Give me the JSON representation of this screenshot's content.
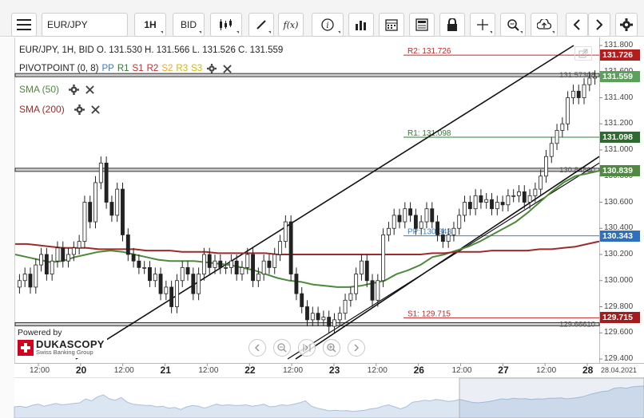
{
  "toolbar": {
    "menu_icon": "hamburger-icon",
    "symbol": "EUR/JPY",
    "timeframe": "1H",
    "side": "BID",
    "buttons": [
      "candles-icon",
      "draw-icon",
      "fx-icon",
      "info-icon",
      "volume-icon",
      "calendar-icon",
      "news-icon",
      "lock-icon",
      "crosshair-icon",
      "zoom-icon",
      "upload-icon",
      "prev-icon",
      "next-icon",
      "settings-icon"
    ],
    "fx_label": "f(x)"
  },
  "header": {
    "ohlc_text": "EUR/JPY, 1H, BID   O. 131.530  H. 131.566  L. 131.526  C. 131.559",
    "pivot_label": "PIVOTPOINT (0, 8)",
    "pivot_items": [
      {
        "text": "PP",
        "color": "#2e7fd8"
      },
      {
        "text": "R1",
        "color": "#2e7d32"
      },
      {
        "text": "S1",
        "color": "#c62828"
      },
      {
        "text": "R2",
        "color": "#c62828"
      },
      {
        "text": "S2",
        "color": "#f5a623"
      },
      {
        "text": "R3",
        "color": "#f5c400"
      },
      {
        "text": "S3",
        "color": "#f5c400"
      }
    ],
    "sma50_label": "SMA (50)",
    "sma200_label": "SMA (200)",
    "sma50_color": "#4c8a3c",
    "sma200_color": "#9e2a2a"
  },
  "chart_data": {
    "type": "line",
    "title": "EUR/JPY, 1H, BID",
    "x_labels": [
      "12:00",
      "20",
      "12:00",
      "21",
      "12:00",
      "22",
      "12:00",
      "23",
      "12:00",
      "26",
      "12:00",
      "27",
      "12:00",
      "28"
    ],
    "ylim": [
      129.4,
      131.8
    ],
    "y_ticks": [
      129.4,
      129.6,
      129.8,
      130.0,
      130.2,
      130.4,
      130.6,
      130.8,
      131.0,
      131.2,
      131.4,
      131.6,
      131.8
    ],
    "y_tick_labels": [
      "129.400",
      "129.600",
      "129.800",
      "130.000",
      "130.200",
      "130.400",
      "130.600",
      "130.800",
      "131.000",
      "131.200",
      "131.400",
      "131.600",
      "131.800"
    ],
    "ohlc": {
      "open": 131.53,
      "high": 131.566,
      "low": 131.526,
      "close": 131.559
    },
    "close_series": [
      130.0,
      130.05,
      129.95,
      130.12,
      130.2,
      130.05,
      130.15,
      130.25,
      130.15,
      130.2,
      130.25,
      130.3,
      130.6,
      130.45,
      130.75,
      130.9,
      130.6,
      130.5,
      130.7,
      130.35,
      130.2,
      130.15,
      130.1,
      130.1,
      130.0,
      130.05,
      129.9,
      129.95,
      129.8,
      130.0,
      130.1,
      130.05,
      129.9,
      130.05,
      130.2,
      130.1,
      130.15,
      130.1,
      130.1,
      130.15,
      130.05,
      130.1,
      130.2,
      130.0,
      130.05,
      130.15,
      130.1,
      130.2,
      130.3,
      130.45,
      130.05,
      129.9,
      129.8,
      129.7,
      129.75,
      129.7,
      129.72,
      129.65,
      129.7,
      129.75,
      129.85,
      129.9,
      130.05,
      130.15,
      130.0,
      129.85,
      130.0,
      130.35,
      130.4,
      130.5,
      130.45,
      130.55,
      130.5,
      130.4,
      130.45,
      130.55,
      130.45,
      130.35,
      130.3,
      130.35,
      130.4,
      130.5,
      130.6,
      130.55,
      130.65,
      130.6,
      130.62,
      130.55,
      130.6,
      130.58,
      130.65,
      130.65,
      130.68,
      130.6,
      130.65,
      130.7,
      130.8,
      130.95,
      131.05,
      131.15,
      131.2,
      131.4,
      131.45,
      131.4,
      131.5,
      131.55,
      131.56
    ],
    "series": [
      {
        "name": "SMA (50)",
        "values": [
          130.2,
          130.18,
          130.16,
          130.14,
          130.15,
          130.18,
          130.2,
          130.22,
          130.23,
          130.22,
          130.2,
          130.18,
          130.16,
          130.15,
          130.15,
          130.15,
          130.14,
          130.13,
          130.12,
          130.1,
          130.08,
          130.05,
          130.02,
          130.0,
          129.99,
          129.97,
          129.96,
          129.95,
          129.95,
          129.96,
          129.98,
          130.0,
          130.05,
          130.08,
          130.12,
          130.18,
          130.2,
          130.23,
          130.26,
          130.3,
          130.35,
          130.4,
          130.45,
          130.52,
          130.6,
          130.68,
          130.75,
          130.8,
          130.82,
          130.84
        ]
      },
      {
        "name": "SMA (200)",
        "values": [
          130.28,
          130.28,
          130.27,
          130.26,
          130.25,
          130.25,
          130.25,
          130.24,
          130.24,
          130.24,
          130.24,
          130.23,
          130.23,
          130.23,
          130.22,
          130.22,
          130.22,
          130.21,
          130.21,
          130.21,
          130.21,
          130.21,
          130.2,
          130.2,
          130.2,
          130.2,
          130.2,
          130.2,
          130.2,
          130.2,
          130.2,
          130.2,
          130.2,
          130.2,
          130.2,
          130.21,
          130.21,
          130.22,
          130.22,
          130.22,
          130.23,
          130.23,
          130.23,
          130.23,
          130.24,
          130.24,
          130.25,
          130.26,
          130.28,
          130.3
        ]
      }
    ],
    "pivot_levels": [
      {
        "name": "R2",
        "text": "R2: 131.726",
        "value": 131.726,
        "color": "#c62828"
      },
      {
        "name": "R1",
        "text": "R1: 131.098",
        "value": 131.098,
        "color": "#2e7d32"
      },
      {
        "name": "PP",
        "text": "PP: 130.343",
        "value": 130.343,
        "color": "#2e7fd8"
      },
      {
        "name": "S1",
        "text": "S1: 129.715",
        "value": 129.715,
        "color": "#c62828"
      }
    ],
    "horizontal_lines": [
      {
        "text": "131.57308",
        "value": 131.57308
      },
      {
        "text": "130.84800",
        "value": 130.848
      },
      {
        "text": "129.66610",
        "value": 129.6661
      }
    ],
    "price_tags": [
      {
        "text": "131.726",
        "value": 131.726,
        "color": "#b71c1c"
      },
      {
        "text": "131.559",
        "value": 131.559,
        "color": "#5aa15a"
      },
      {
        "text": "131.098",
        "value": 131.098,
        "color": "#2e6b2e"
      },
      {
        "text": "130.839",
        "value": 130.839,
        "color": "#4f8a3f"
      },
      {
        "text": "130.343",
        "value": 130.343,
        "color": "#2f6fbf"
      },
      {
        "text": "129.715",
        "value": 129.715,
        "color": "#a61c1c"
      }
    ],
    "grid": false,
    "legend": "top-left"
  },
  "footer": {
    "date_tag": "28.04.2021",
    "brand_top": "Powered by",
    "brand_name": "DUKASCOPY",
    "brand_sub": "Swiss Banking Group"
  }
}
